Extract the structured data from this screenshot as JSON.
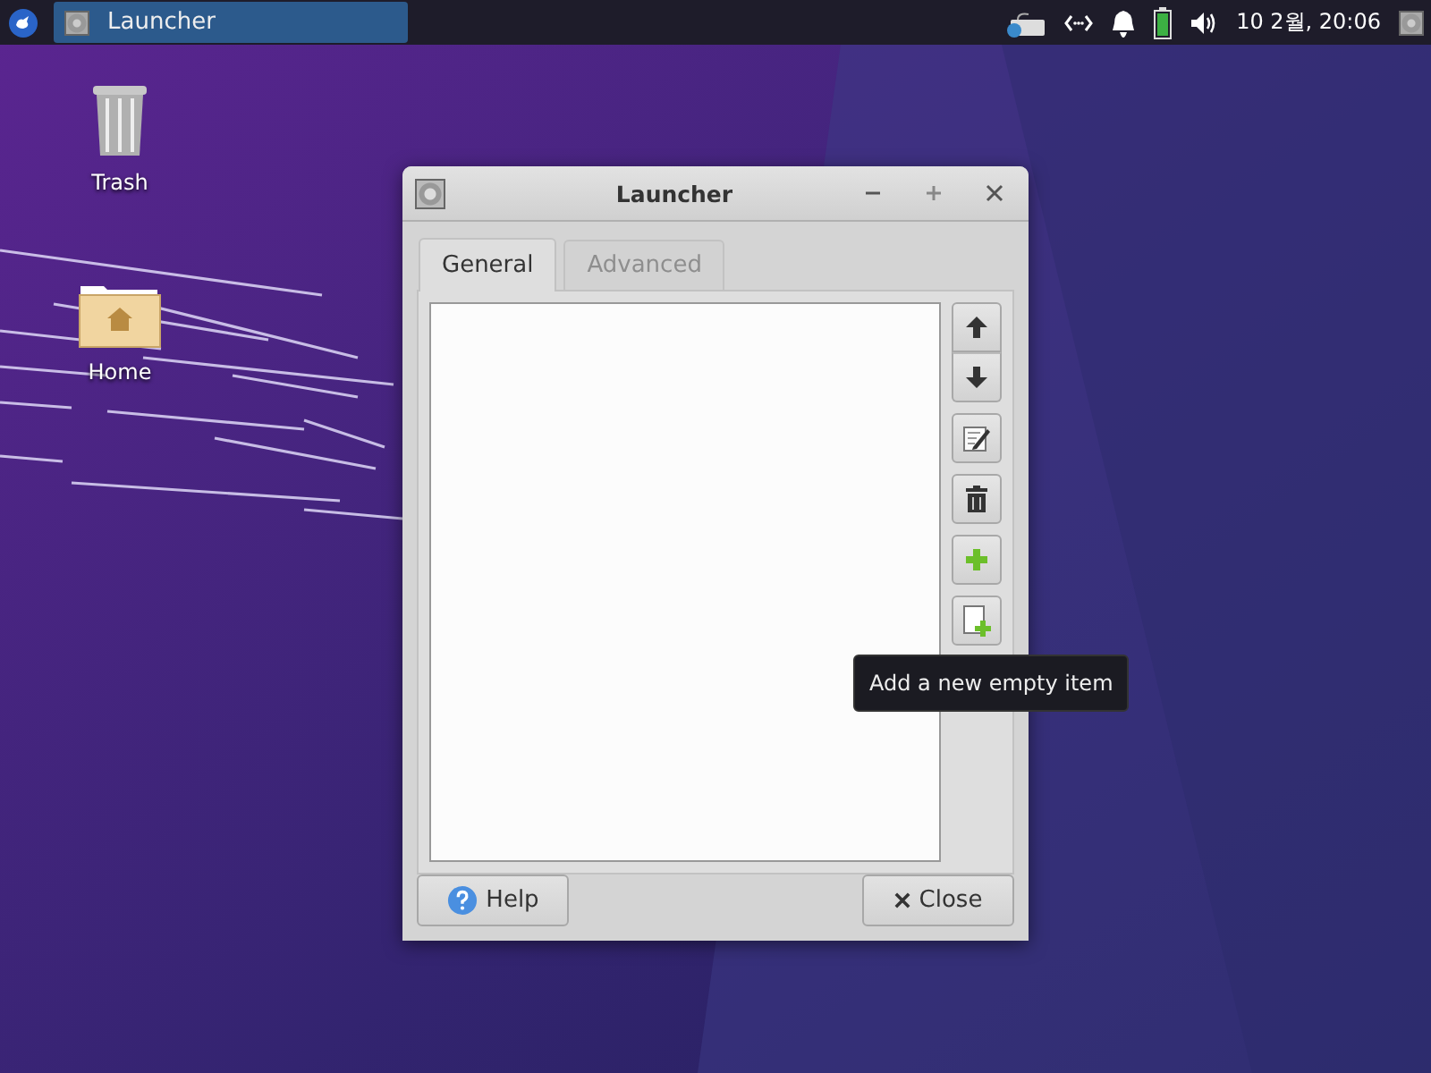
{
  "panel": {
    "taskbar_items": [
      {
        "label": "Launcher",
        "selected": true
      }
    ],
    "clock": "10 2월, 20:06"
  },
  "desktop_icons": [
    {
      "label": "Trash",
      "kind": "trash"
    },
    {
      "label": "Home",
      "kind": "folder"
    }
  ],
  "window": {
    "title": "Launcher",
    "tabs": [
      {
        "label": "General",
        "selected": true
      },
      {
        "label": "Advanced",
        "selected": false
      }
    ],
    "side_buttons": [
      {
        "kind": "up"
      },
      {
        "kind": "down"
      },
      {
        "kind": "edit"
      },
      {
        "kind": "delete"
      },
      {
        "kind": "add"
      },
      {
        "kind": "new"
      }
    ],
    "tooltip": "Add a new empty item",
    "buttons": [
      {
        "label": "Help",
        "kind": "help"
      },
      {
        "label": "Close",
        "kind": "close"
      }
    ]
  }
}
